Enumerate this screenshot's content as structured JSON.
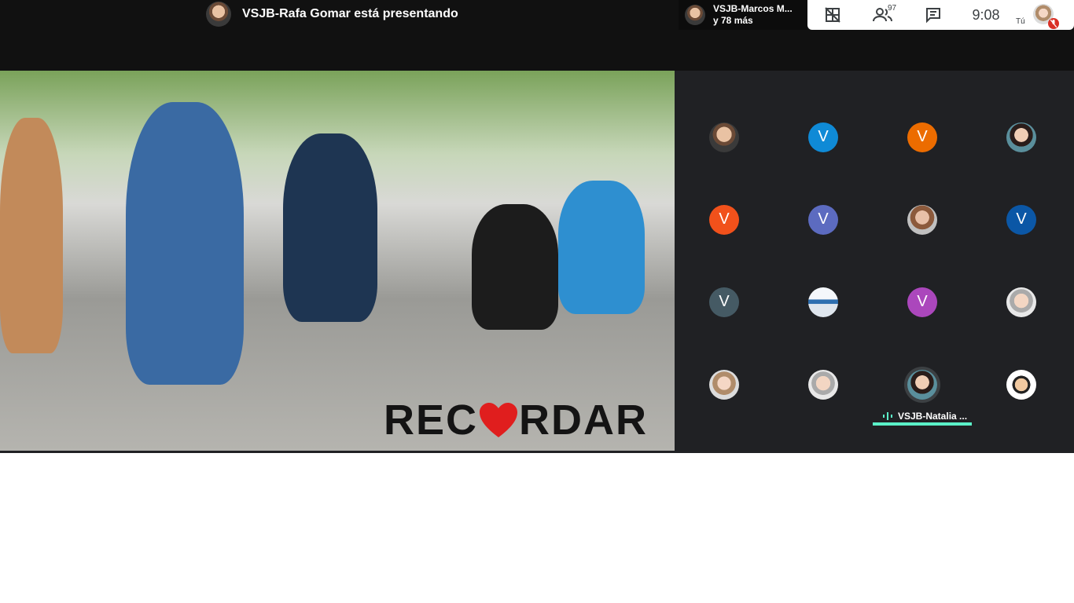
{
  "presenter": {
    "text": "VSJB-Rafa Gomar está presentando"
  },
  "speaker_chip": {
    "name": "VSJB-Marcos M...",
    "more": "y 78 más"
  },
  "toolbar": {
    "participants_count": "97",
    "time": "9:08",
    "self_label": "Tú"
  },
  "slide": {
    "logo_text": "REC",
    "logo_text_2": "RDAR"
  },
  "participants": [
    {
      "initial": "",
      "kind": "photo",
      "color": ""
    },
    {
      "initial": "V",
      "kind": "letter",
      "color": "#0f8ad6"
    },
    {
      "initial": "V",
      "kind": "letter",
      "color": "#ec6c00"
    },
    {
      "initial": "",
      "kind": "photo",
      "color": ""
    },
    {
      "initial": "V",
      "kind": "letter",
      "color": "#f1511b"
    },
    {
      "initial": "V",
      "kind": "letter",
      "color": "#5c6bc0"
    },
    {
      "initial": "",
      "kind": "photo",
      "color": ""
    },
    {
      "initial": "V",
      "kind": "letter",
      "color": "#0b57a6"
    },
    {
      "initial": "V",
      "kind": "letter",
      "color": "#455a64"
    },
    {
      "initial": "",
      "kind": "photo",
      "color": ""
    },
    {
      "initial": "V",
      "kind": "letter",
      "color": "#ab47bc"
    },
    {
      "initial": "",
      "kind": "photo",
      "color": ""
    },
    {
      "initial": "",
      "kind": "photo",
      "color": ""
    },
    {
      "initial": "",
      "kind": "photo",
      "color": ""
    },
    {
      "initial": "",
      "kind": "photo",
      "color": ""
    },
    {
      "initial": "",
      "kind": "photo",
      "color": ""
    }
  ],
  "active_speaker": {
    "name": "VSJB-Natalia ..."
  },
  "colors": {
    "accent": "#5bf1c8",
    "mic_off": "#d93025",
    "bg": "#202124"
  }
}
